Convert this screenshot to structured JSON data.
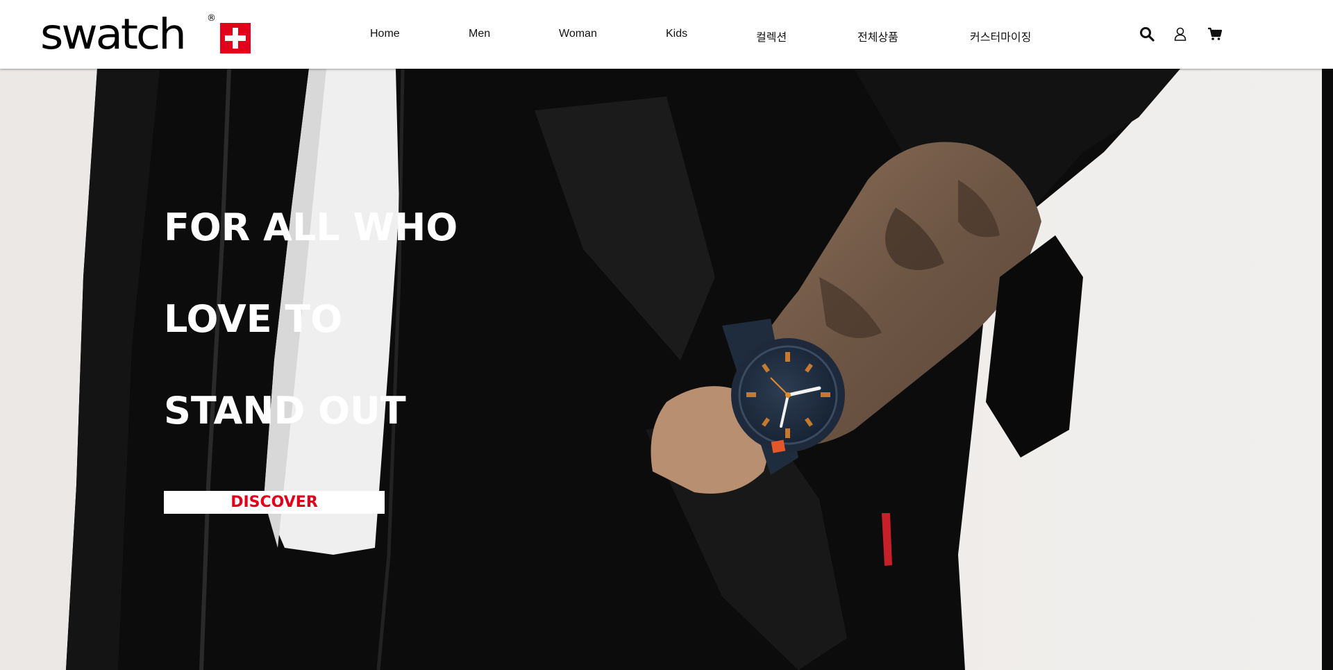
{
  "brand": {
    "logo_text": "swatch",
    "registered_mark": "®",
    "flag_color": "#e3001b"
  },
  "nav": {
    "items": [
      {
        "label": "Home"
      },
      {
        "label": "Men"
      },
      {
        "label": "Woman"
      },
      {
        "label": "Kids"
      },
      {
        "label": "컬렉션"
      },
      {
        "label": "전체상품"
      },
      {
        "label": "커스터마이징"
      }
    ]
  },
  "header_icons": [
    "search-icon",
    "user-icon",
    "cart-icon"
  ],
  "hero": {
    "headline_lines": [
      "FOR ALL WHO",
      "LOVE TO",
      "STAND OUT"
    ],
    "cta_label": "DISCOVER",
    "cta_text_color": "#e3001b",
    "image_description": "Man in black fleece jacket with tiger-tattooed forearm wearing a navy and orange watch"
  },
  "colors": {
    "accent": "#e3001b",
    "header_bg": "#ffffff",
    "hero_text": "#ffffff"
  }
}
